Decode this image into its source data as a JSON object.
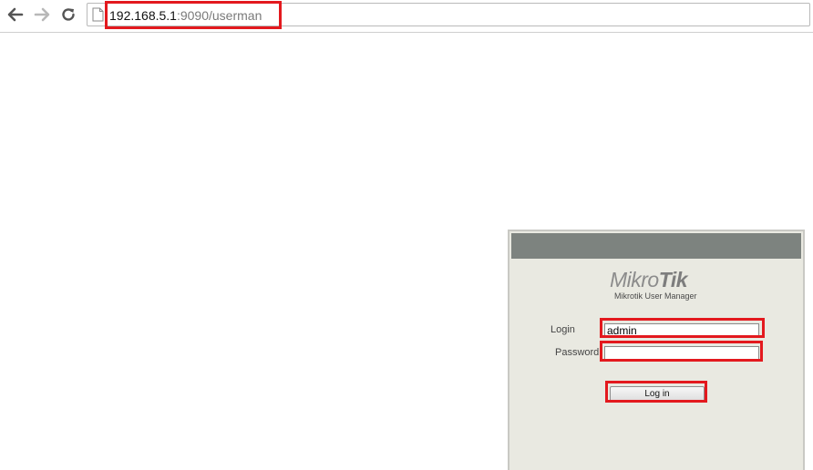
{
  "browser": {
    "back_icon": "arrow-left-icon",
    "forward_icon": "arrow-right-icon",
    "reload_icon": "reload-icon",
    "page_icon": "document-icon",
    "url_host": "192.168.5.1",
    "url_rest": ":9090/userman"
  },
  "login_panel": {
    "header_color": "#7d837f",
    "logo_light": "Mikro",
    "logo_bold": "Tik",
    "subtitle": "Mikrotik User Manager",
    "login_label": "Login",
    "login_value": "admin",
    "password_label": "Password",
    "password_value": "",
    "submit_label": "Log in"
  },
  "highlight_color": "#e3191e"
}
